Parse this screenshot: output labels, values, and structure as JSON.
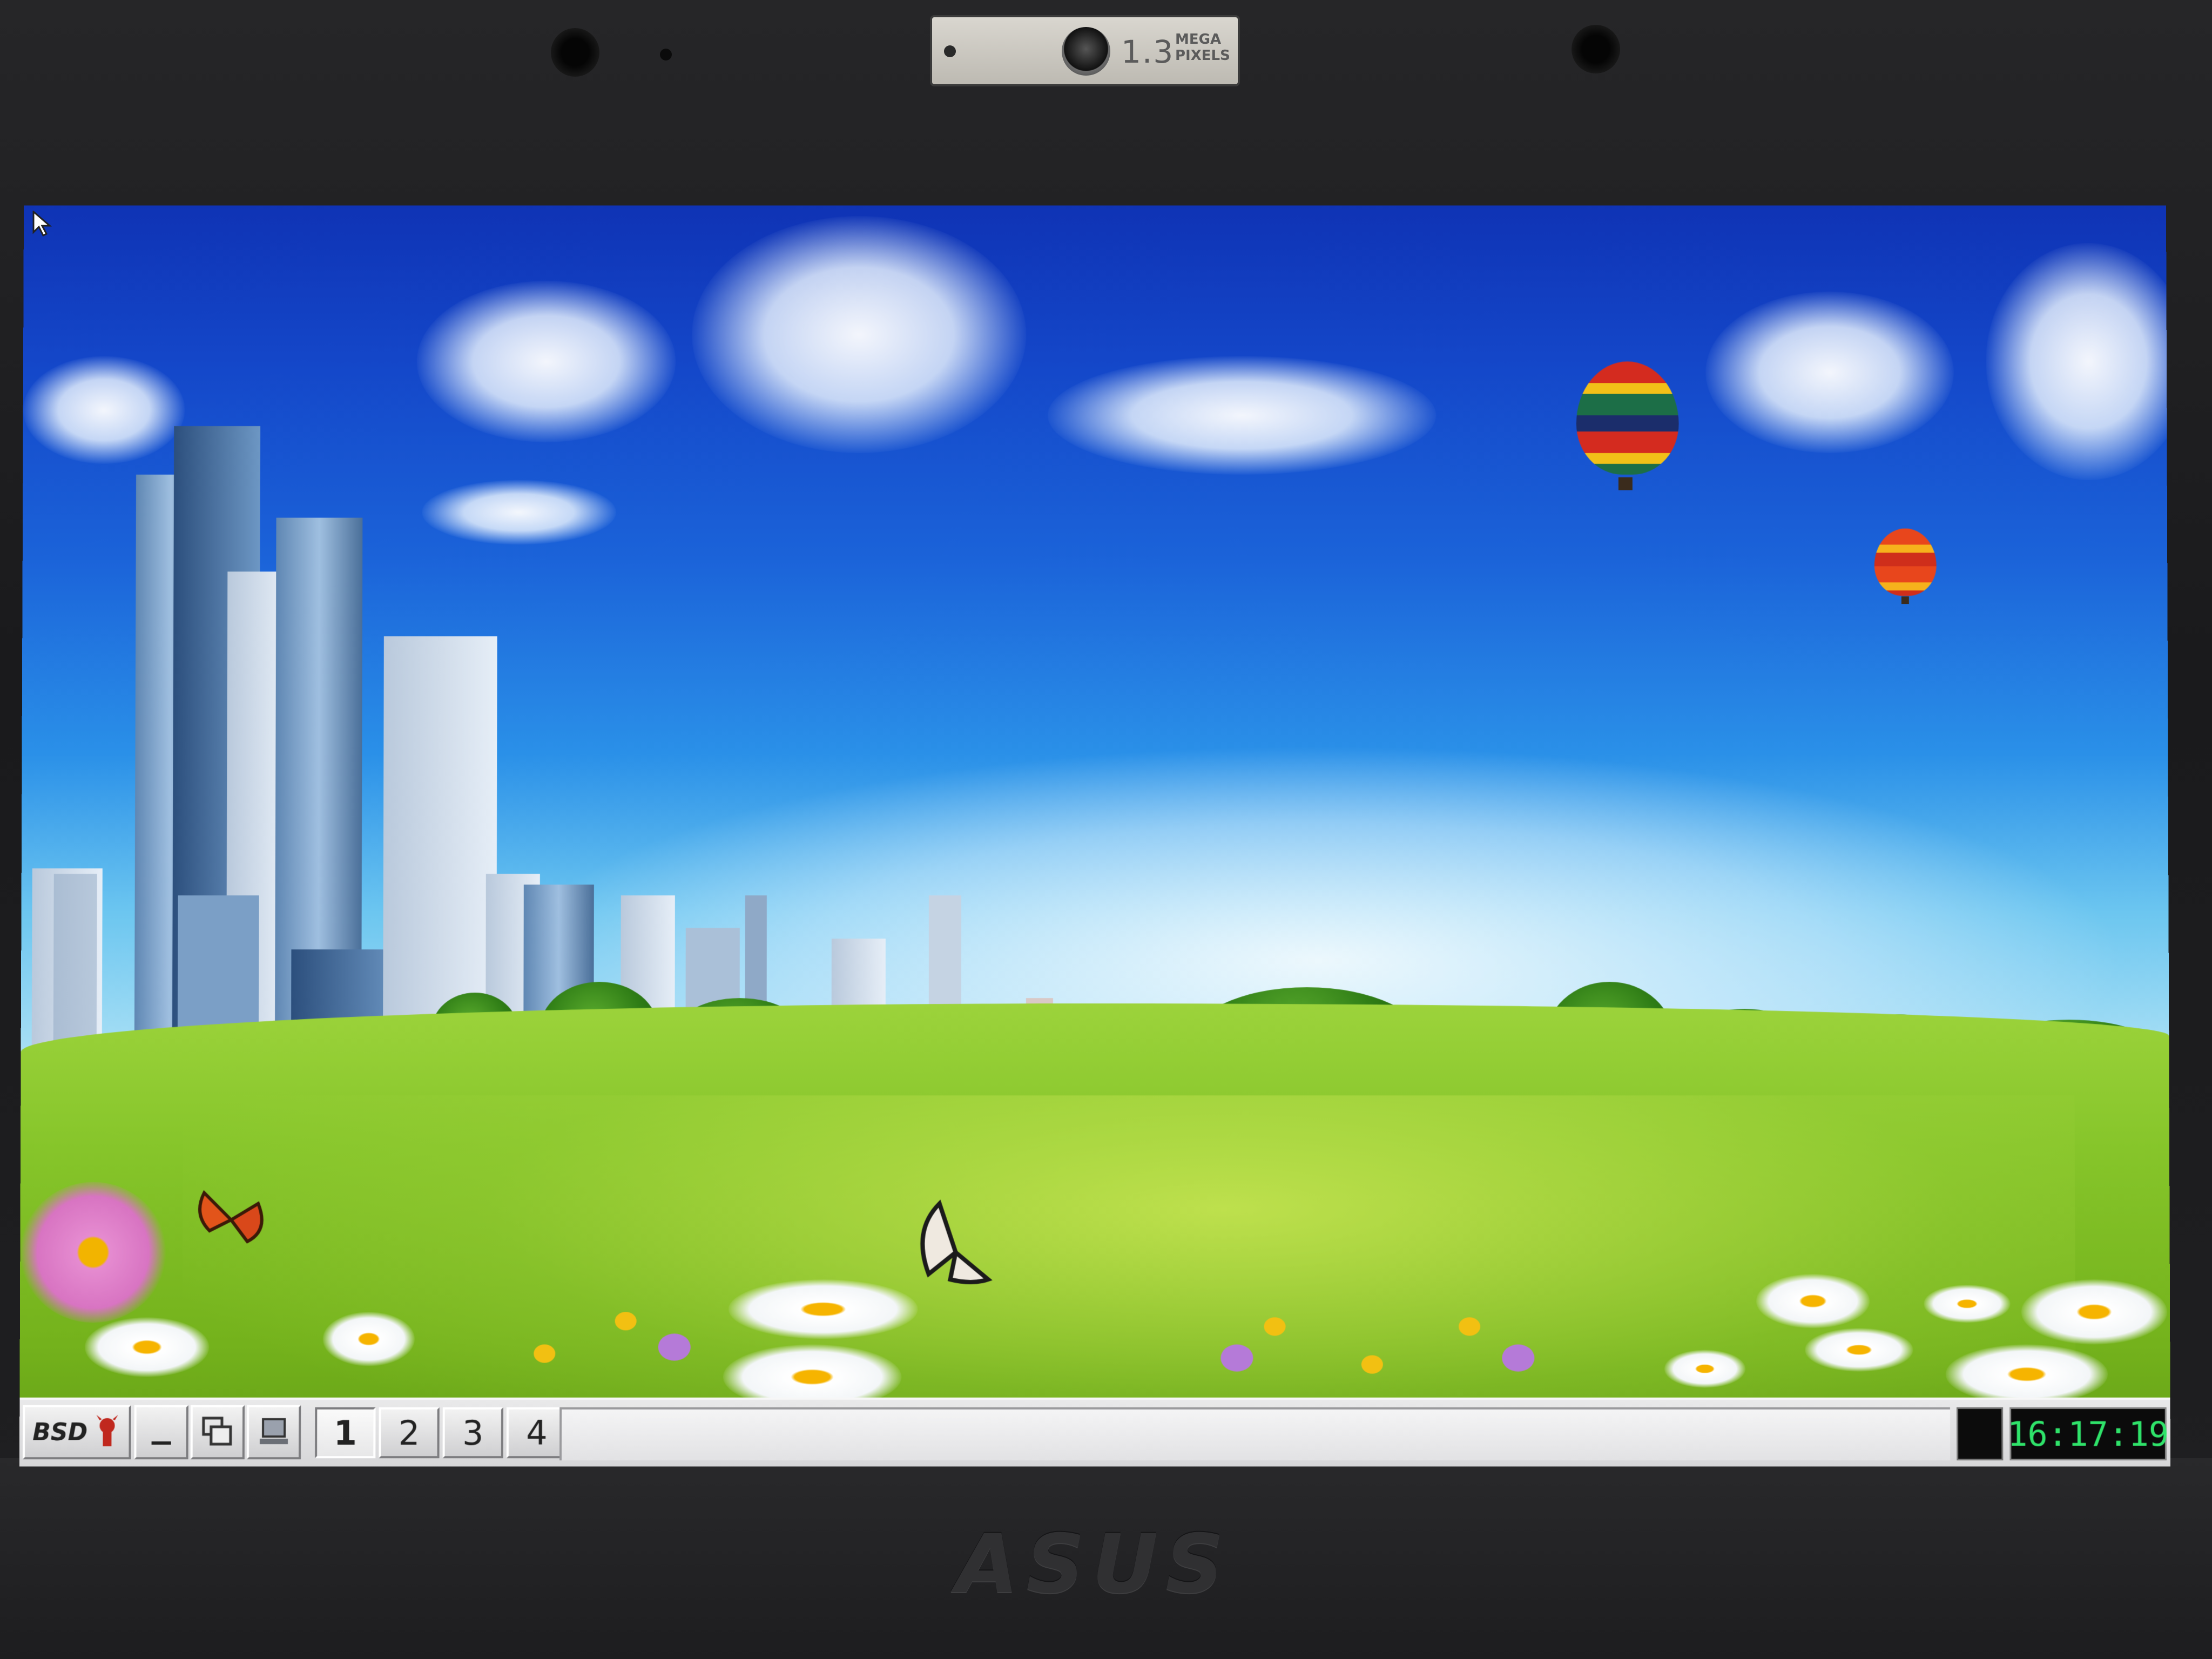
{
  "camera": {
    "megapixels": "1.3",
    "label": "MEGA PIXELS"
  },
  "laptop_brand": "ASUS",
  "taskbar": {
    "start_label": "BSD",
    "workspaces": [
      {
        "label": "1",
        "active": true
      },
      {
        "label": "2",
        "active": false
      },
      {
        "label": "3",
        "active": false
      },
      {
        "label": "4",
        "active": false
      }
    ],
    "clock": "16:17:19"
  },
  "colors": {
    "clock_text": "#2fe36a",
    "taskbar_bg": "#e0e0e2"
  },
  "icons": {
    "start": "bsd-daemon-icon",
    "minimize": "minimize-all-icon",
    "window_list": "window-list-icon",
    "show_desktop": "show-desktop-icon"
  }
}
